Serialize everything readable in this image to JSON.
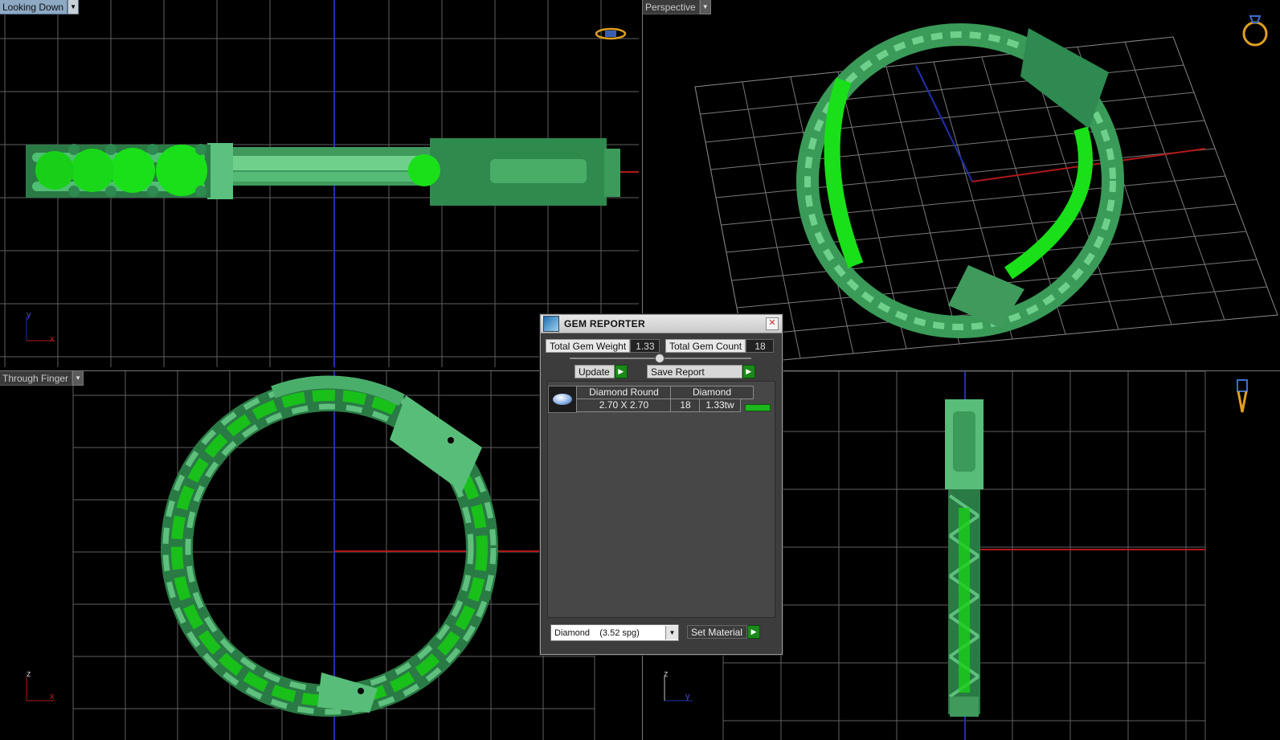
{
  "viewports": {
    "top_left": {
      "label": "Looking Down"
    },
    "top_right": {
      "label": "Perspective"
    },
    "bottom_left": {
      "label": "Through Finger"
    },
    "bottom_right": {
      "label": ""
    }
  },
  "axes": {
    "top_left": {
      "a": "y",
      "b": "x"
    },
    "bottom_left": {
      "a": "z",
      "b": "x"
    },
    "bottom_right": {
      "a": "z",
      "b": "y"
    }
  },
  "icons": {
    "top_left": "ring-top-view-icon",
    "top_right": "ring-perspective-icon",
    "bottom_right": "ring-side-icon"
  },
  "gem_reporter": {
    "title": "GEM REPORTER",
    "total_gem_weight_label": "Total Gem Weight",
    "total_gem_weight": "1.33",
    "total_gem_count_label": "Total Gem Count",
    "total_gem_count": "18",
    "update_label": "Update",
    "save_report_label": "Save Report",
    "rows": [
      {
        "shape": "Diamond Round",
        "size": "2.70 X 2.70",
        "material": "Diamond",
        "count": "18",
        "weight": "1.33tw"
      }
    ],
    "material_select": "Diamond    (3.52 spg)",
    "set_material_label": "Set Material"
  },
  "colors": {
    "metal": "#47b36c",
    "gem": "#19e019",
    "grid": "#6c6c6c",
    "axis_x": "#b01818",
    "axis_y": "#2030b0"
  }
}
